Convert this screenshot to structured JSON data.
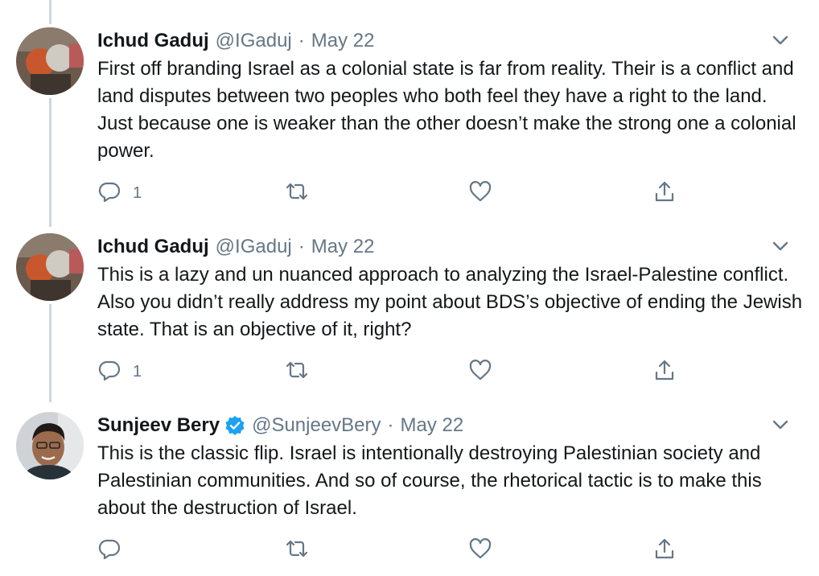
{
  "tweets": [
    {
      "name": "Ichud Gaduj",
      "handle": "@IGaduj",
      "separator": "·",
      "date": "May 22",
      "text": "First off branding Israel as a colonial state is far from reality. Their is a conflict and land disputes between two peoples who both feel they have a right to the land. Just because one is weaker than the other doesn’t make the strong one a colonial power.",
      "reply_count": "1"
    },
    {
      "name": "Ichud Gaduj",
      "handle": "@IGaduj",
      "separator": "·",
      "date": "May 22",
      "text": "This is a lazy and un nuanced approach to analyzing the Israel-Palestine conflict. Also you didn’t really address my point about BDS’s objective of ending the Jewish state. That is an objective of it, right?",
      "reply_count": "1"
    },
    {
      "name": "Sunjeev Bery",
      "handle": "@SunjeevBery",
      "separator": "·",
      "date": "May 22",
      "text": "This is the classic flip. Israel is intentionally destroying Palestinian society and Palestinian communities. And so of course, the rhetorical tactic is to make this about the destruction of Israel.",
      "reply_count": ""
    }
  ],
  "colors": {
    "text": "#14171a",
    "secondary": "#657786",
    "thread_line": "#ccd6dd",
    "verified": "#1da1f2"
  },
  "icons": [
    "reply-icon",
    "retweet-icon",
    "like-icon",
    "share-icon",
    "chevron-down-icon",
    "verified-badge-icon"
  ]
}
